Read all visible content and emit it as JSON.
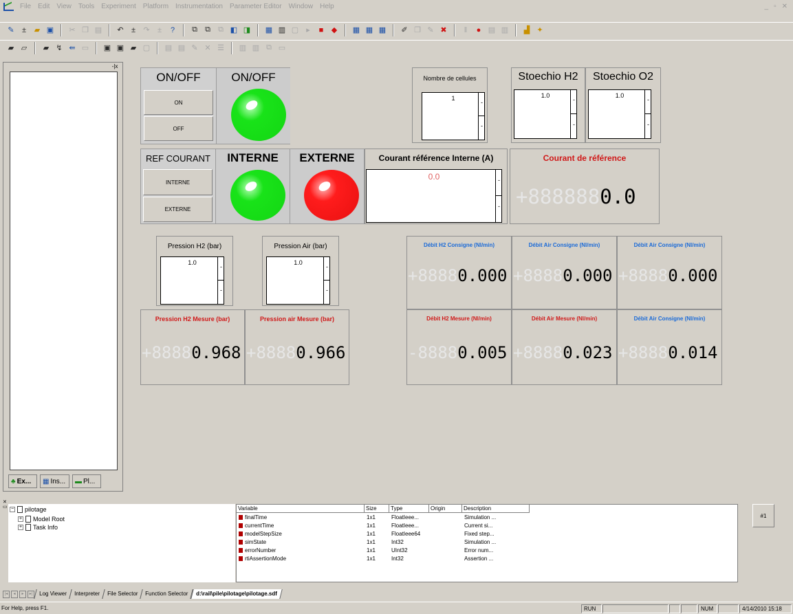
{
  "window": {
    "menu": [
      "File",
      "Edit",
      "View",
      "Tools",
      "Experiment",
      "Platform",
      "Instrumentation",
      "Parameter Editor",
      "Window",
      "Help"
    ],
    "controls": [
      "_",
      "▫",
      "✕"
    ]
  },
  "explorer": {
    "close": "-|x",
    "tabs": [
      "Ex...",
      "Ins...",
      "Pl..."
    ]
  },
  "panel": {
    "onoff": {
      "title_left": "ON/OFF",
      "title_right": "ON/OFF",
      "btn_on": "ON",
      "btn_off": "OFF",
      "led_color": "#19e319"
    },
    "ref": {
      "title": "REF COURANT",
      "btn_interne": "INTERNE",
      "btn_externe": "EXTERNE",
      "title_interne": "INTERNE",
      "title_externe": "EXTERNE",
      "led_interne_color": "#19e319",
      "led_externe_color": "#ff1c1c"
    },
    "nombre_cellules": {
      "label": "Nombre de cellules",
      "value": "1"
    },
    "stoechio_h2": {
      "label": "Stoechio H2",
      "value": "1.0"
    },
    "stoechio_o2": {
      "label": "Stoechio O2",
      "value": "1.0"
    },
    "courant_interne": {
      "label": "Courant référence Interne (A)",
      "value": "0.0",
      "value_color": "#e06060"
    },
    "courant_reference": {
      "label": "Courant de référence",
      "ghost": "+888888",
      "value": "0.0",
      "label_color": "#d01818"
    },
    "pression_h2": {
      "label": "Pression H2 (bar)",
      "value": "1.0"
    },
    "pression_air": {
      "label": "Pression Air (bar)",
      "value": "1.0"
    },
    "debit_consigne": [
      {
        "label": "Débit H2 Consigne (Nl/min)",
        "ghost": "+8888",
        "value": "0.000"
      },
      {
        "label": "Débit Air Consigne (Nl/min)",
        "ghost": "+8888",
        "value": "0.000"
      },
      {
        "label": "Débit Air Consigne (Nl/min)",
        "ghost": "+8888",
        "value": "0.000"
      }
    ],
    "pression_mesure": [
      {
        "label": "Pression H2 Mesure (bar)",
        "ghost": "+8888",
        "value": "0.968"
      },
      {
        "label": "Pression air Mesure (bar)",
        "ghost": "+8888",
        "value": "0.966"
      }
    ],
    "debit_mesure": [
      {
        "label": "Débit H2 Mesure (Nl/min)",
        "ghost": "-8888",
        "value": "0.005",
        "label_color": "#d01818"
      },
      {
        "label": "Débit Air Mesure (Nl/min)",
        "ghost": "+8888",
        "value": "0.023",
        "label_color": "#d01818"
      },
      {
        "label": "Débit Air Consigne (Nl/min)",
        "ghost": "+8888",
        "value": "0.014",
        "label_color": "#1a6ad8"
      }
    ]
  },
  "tree": {
    "root": "pilotage",
    "children": [
      "Model Root",
      "Task Info"
    ]
  },
  "vartable": {
    "headers": [
      "Variable",
      "Size",
      "Type",
      "Origin",
      "Description"
    ],
    "rows": [
      {
        "variable": "finalTime",
        "size": "1x1",
        "type": "FloatIeee...",
        "origin": "",
        "description": "Simulation ..."
      },
      {
        "variable": "currentTime",
        "size": "1x1",
        "type": "FloatIeee...",
        "origin": "",
        "description": "Current si..."
      },
      {
        "variable": "modelStepSize",
        "size": "1x1",
        "type": "FloatIeee64",
        "origin": "",
        "description": "Fixed step..."
      },
      {
        "variable": "simState",
        "size": "1x1",
        "type": "Int32",
        "origin": "",
        "description": "Simulation ..."
      },
      {
        "variable": "errorNumber",
        "size": "1x1",
        "type": "UInt32",
        "origin": "",
        "description": "Error num..."
      },
      {
        "variable": "rtiAssertionMode",
        "size": "1x1",
        "type": "Int32",
        "origin": "",
        "description": "Assertion ..."
      }
    ],
    "hash_button": "#1"
  },
  "bottom_tabs": [
    "Log Viewer",
    "Interpreter",
    "File Selector",
    "Function Selector",
    "d:\\rail\\pile\\pilotage\\pilotage.sdf"
  ],
  "status": {
    "help": "For Help, press F1.",
    "run": "RUN",
    "num": "NUM",
    "datetime": "4/14/2010 15:18"
  }
}
